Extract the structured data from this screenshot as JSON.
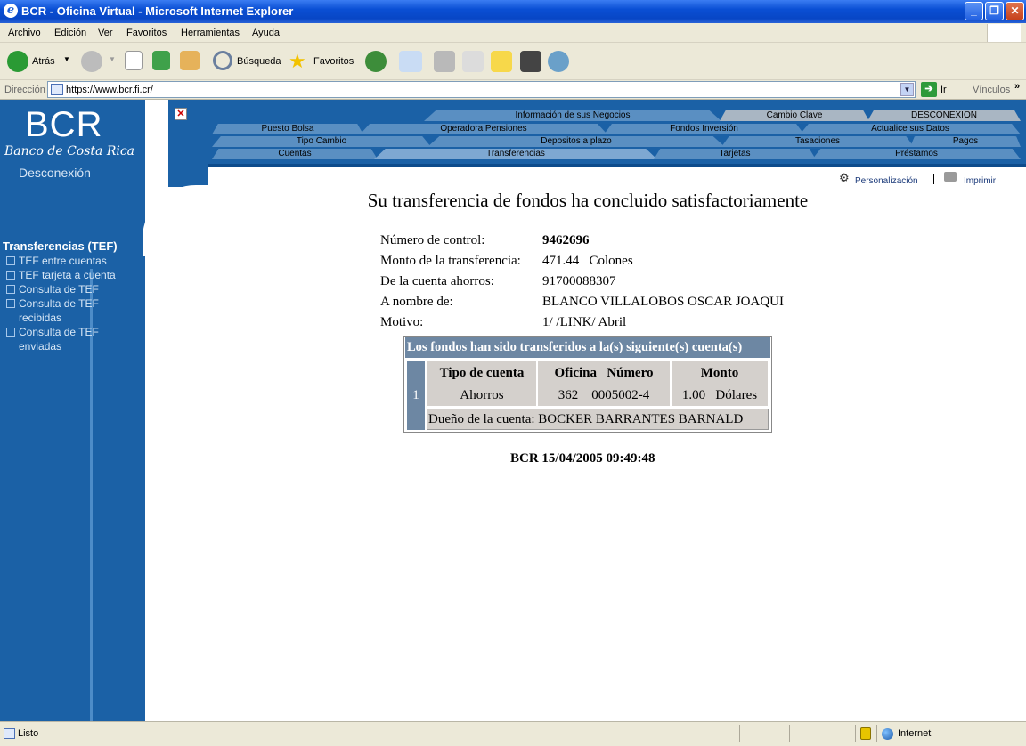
{
  "window": {
    "title": "BCR - Oficina Virtual - Microsoft Internet Explorer"
  },
  "menu": [
    "Archivo",
    "Edición",
    "Ver",
    "Favoritos",
    "Herramientas",
    "Ayuda"
  ],
  "toolbar": {
    "back": "Atrás",
    "search": "Búsqueda",
    "favorites": "Favoritos"
  },
  "address": {
    "label": "Dirección",
    "url": "https://www.bcr.fi.cr/",
    "go": "Ir",
    "links": "Vínculos"
  },
  "logo": {
    "name": "BCR",
    "subtitle": "Banco de Costa Rica",
    "disconnect": "Desconexión"
  },
  "nav": {
    "row1": [
      "Información de sus Negocios",
      "Cambio Clave",
      "DESCONEXION"
    ],
    "row2": [
      "Puesto Bolsa",
      "Operadora Pensiones",
      "Fondos Inversión",
      "Actualice sus Datos"
    ],
    "row3": [
      "Tipo Cambio",
      "Depositos a plazo",
      "Tasaciones",
      "Pagos"
    ],
    "row4": [
      "Cuentas",
      "Transferencias",
      "Tarjetas",
      "Préstamos"
    ]
  },
  "side_menu": {
    "heading": "Transferencias (TEF)",
    "items": [
      "TEF entre cuentas",
      "TEF tarjeta a cuenta",
      "Consulta de TEF",
      "Consulta de TEF recibidas",
      "Consulta de TEF enviadas"
    ]
  },
  "tools": {
    "personalize": "Personalización",
    "print": "Imprimir"
  },
  "receipt": {
    "heading": "Su transferencia de fondos ha concluido satisfactoriamente",
    "control_label": "Número de control:",
    "control_value": "9462696",
    "amount_label": "Monto de la transferencia:",
    "amount_value": "471.44   Colones",
    "from_label": "De la cuenta ahorros:",
    "from_value": "91700088307",
    "name_label": "A nombre de:",
    "name_value": "BLANCO VILLALOBOS OSCAR JOAQUI",
    "reason_label": "Motivo:",
    "reason_value": "1/ /LINK/ Abril"
  },
  "table": {
    "caption": "Los fondos han sido transferidos a la(s) siguiente(s) cuenta(s)",
    "row_number": "1",
    "h_type": "Tipo de cuenta",
    "h_office_number": "Oficina   Número",
    "h_amount": "Monto",
    "type": "Ahorros",
    "office_number": "362    0005002-4",
    "amount": "1.00   Dólares",
    "owner": "Dueño de la cuenta: BOCKER BARRANTES BARNALD"
  },
  "stamp": "BCR  15/04/2005 09:49:48",
  "status": {
    "text": "Listo",
    "zone": "Internet"
  }
}
